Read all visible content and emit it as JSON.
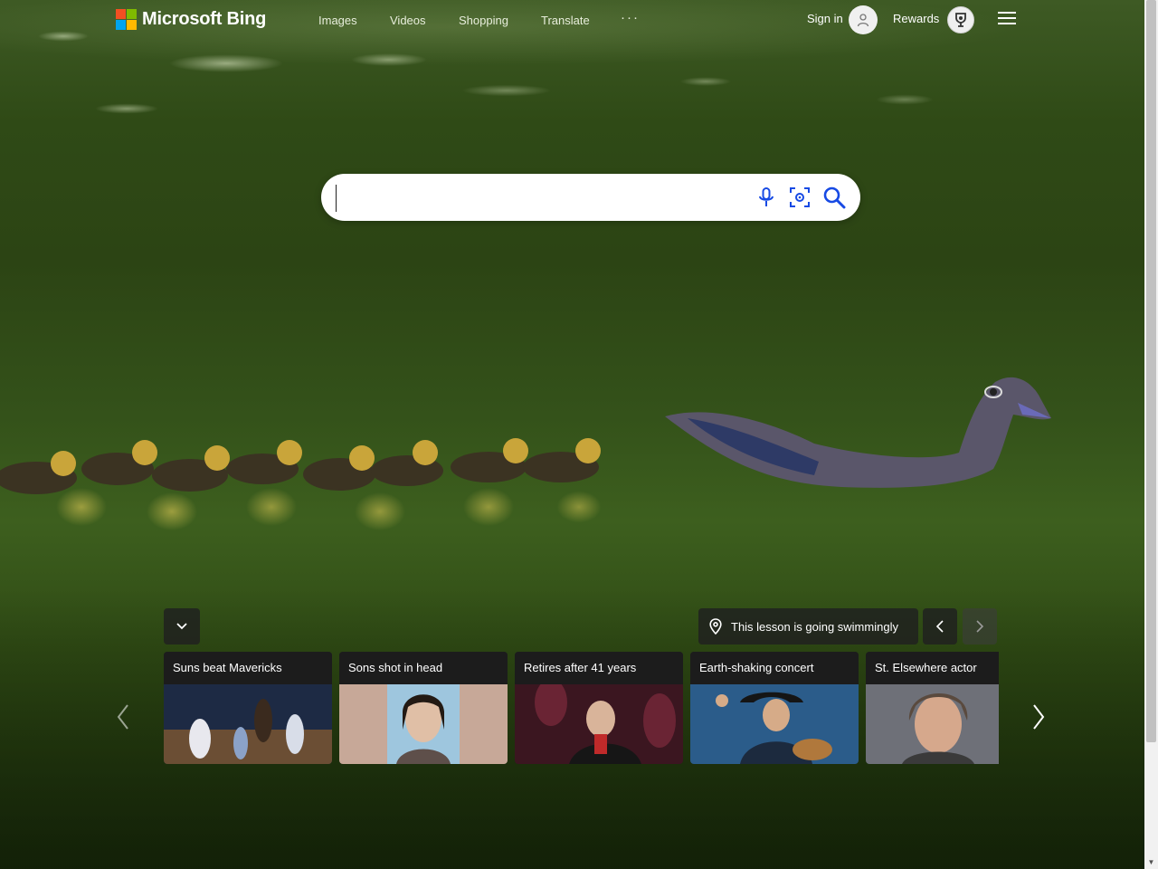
{
  "header": {
    "logo_text": "Microsoft Bing",
    "logo_colors": [
      "#f25022",
      "#7fba00",
      "#00a4ef",
      "#ffb900"
    ],
    "nav": [
      {
        "label": "Images"
      },
      {
        "label": "Videos"
      },
      {
        "label": "Shopping"
      },
      {
        "label": "Translate"
      },
      {
        "label": "···"
      }
    ],
    "signin_label": "Sign in",
    "rewards_label": "Rewards"
  },
  "search": {
    "value": "",
    "placeholder": "",
    "icons": [
      "microphone-icon",
      "visual-search-icon",
      "search-icon"
    ],
    "accent": "#174ae4"
  },
  "image_of_day": {
    "caption": "This lesson is going swimmingly"
  },
  "news": [
    {
      "title": "Suns beat Mavericks"
    },
    {
      "title": "Sons shot in head"
    },
    {
      "title": "Retires after 41 years"
    },
    {
      "title": "Earth-shaking concert"
    },
    {
      "title": "St. Elsewhere actor"
    }
  ]
}
